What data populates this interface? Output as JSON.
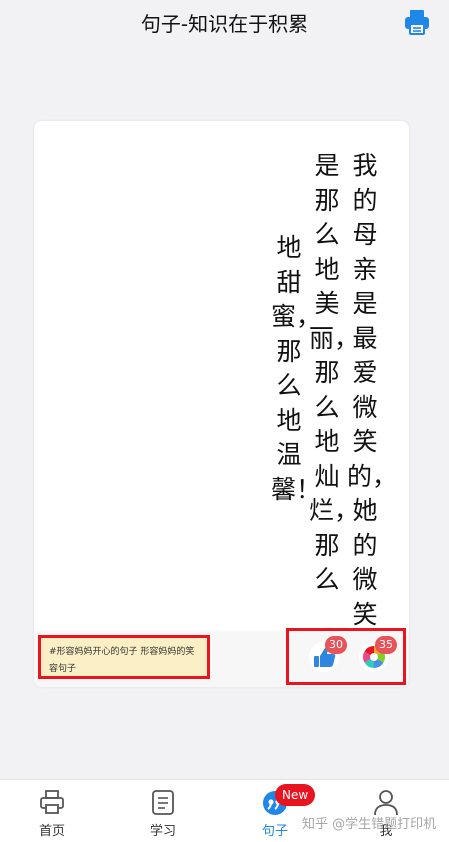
{
  "header": {
    "title": "句子-知识在于积累",
    "print_icon": "printer-icon",
    "accent_color": "#1f87e8"
  },
  "quote": {
    "column_1": "我的母亲是最爱微笑的，她的微笑",
    "column_2": "是那么地美丽，那么地灿烂，那么",
    "column_3": "地甜蜜，那么地温馨！"
  },
  "card_footer": {
    "tags": "#形容妈妈开心的句子 形容妈妈的笑容句子",
    "like_count": "30",
    "share_count": "35",
    "like_icon": "thumbs-up-icon",
    "share_icon": "colorful-pinwheel-icon",
    "highlight_color": "#e8141f"
  },
  "tabbar": {
    "tabs": [
      {
        "label": "首页",
        "icon": "printer-icon"
      },
      {
        "label": "学习",
        "icon": "notebook-icon"
      },
      {
        "label": "句子",
        "icon": "quote-icon",
        "active": true
      },
      {
        "label": "我",
        "icon": "user-icon"
      }
    ],
    "new_badge": "New"
  },
  "watermark": "知乎 @学生错题打印机"
}
